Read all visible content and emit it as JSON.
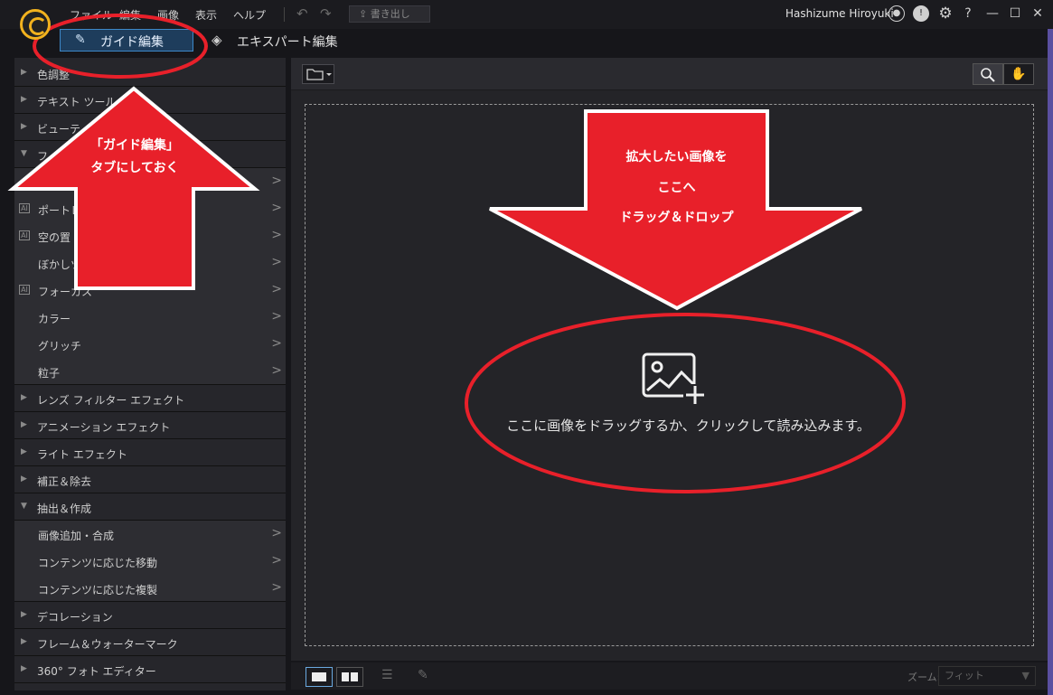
{
  "menu": {
    "file": "ファイル",
    "edit": "編集",
    "image": "画像",
    "view": "表示",
    "help": "ヘルプ"
  },
  "toolbar": {
    "export_label": "書き出し"
  },
  "account": {
    "username": "Hashizume Hiroyuki"
  },
  "tabs": {
    "guide": "ガイド編集",
    "expert": "エキスパート編集"
  },
  "sidebar": {
    "items": [
      {
        "label": "色調整",
        "kind": "category"
      },
      {
        "label": "テキスト ツール",
        "kind": "category"
      },
      {
        "label": "ビューティー",
        "kind": "category"
      },
      {
        "label": "フ",
        "kind": "category-open"
      },
      {
        "label": "",
        "kind": "sub"
      },
      {
        "label": "ポートレ",
        "kind": "sub-ai"
      },
      {
        "label": "空の置",
        "kind": "sub-ai"
      },
      {
        "label": "ぼかしツ",
        "kind": "sub"
      },
      {
        "label": "フォーカス",
        "kind": "sub-ai"
      },
      {
        "label": "カラー",
        "kind": "sub"
      },
      {
        "label": "グリッチ",
        "kind": "sub"
      },
      {
        "label": "粒子",
        "kind": "sub"
      },
      {
        "label": "レンズ フィルター エフェクト",
        "kind": "category"
      },
      {
        "label": "アニメーション エフェクト",
        "kind": "category"
      },
      {
        "label": "ライト エフェクト",
        "kind": "category"
      },
      {
        "label": "補正＆除去",
        "kind": "category"
      },
      {
        "label": "抽出＆作成",
        "kind": "category-open"
      },
      {
        "label": "画像追加・合成",
        "kind": "sub"
      },
      {
        "label": "コンテンツに応じた移動",
        "kind": "sub"
      },
      {
        "label": "コンテンツに応じた複製",
        "kind": "sub"
      },
      {
        "label": "デコレーション",
        "kind": "category"
      },
      {
        "label": "フレーム＆ウォーターマーク",
        "kind": "category"
      },
      {
        "label": "360° フォト エディター",
        "kind": "category"
      }
    ]
  },
  "workspace": {
    "drop_hint": "ここに画像をドラッグするか、クリックして読み込みます。"
  },
  "bottombar": {
    "zoom_label": "ズーム:",
    "zoom_value": "フィット"
  },
  "annotations": {
    "left_arrow_line1": "「ガイド編集」",
    "left_arrow_line2": "タブにしておく",
    "right_arrow_line1": "拡大したい画像を",
    "right_arrow_line2": "ここへ",
    "right_arrow_line3": "ドラッグ＆ドロップ",
    "accent_color": "#e8202a"
  }
}
